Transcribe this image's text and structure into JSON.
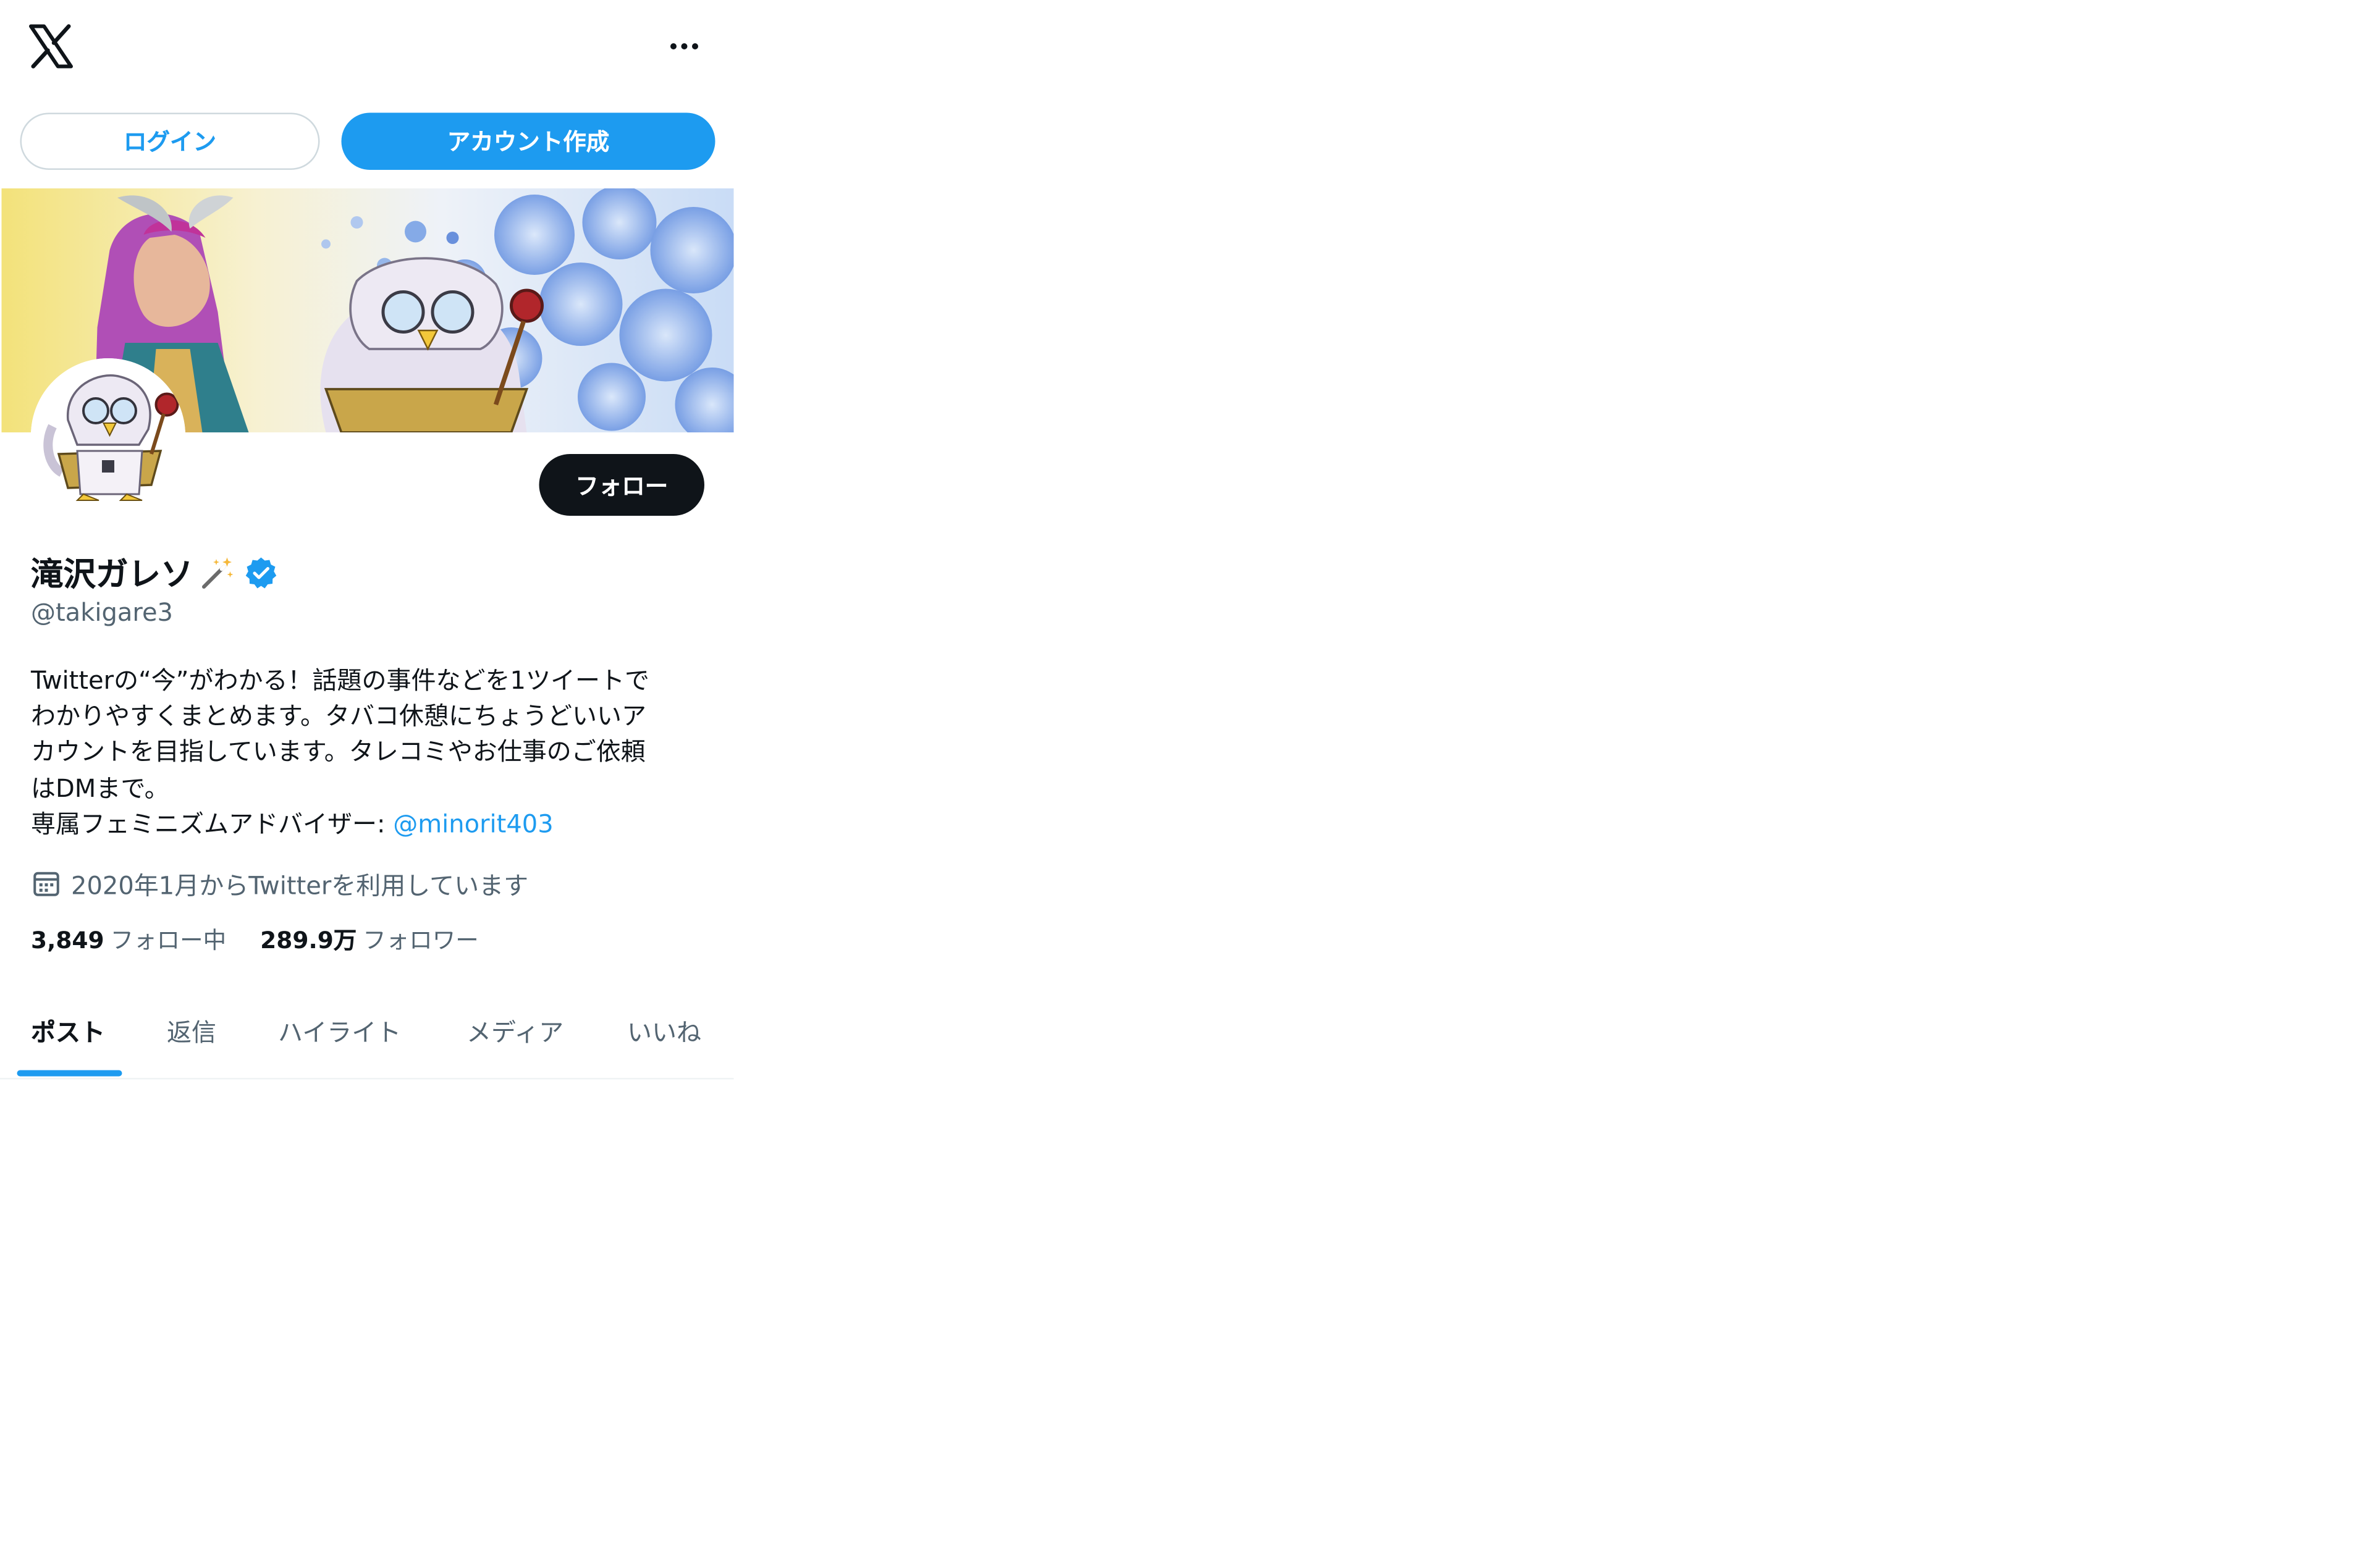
{
  "header": {
    "logo_icon": "x-logo-icon",
    "more_icon": "more-dots-icon"
  },
  "auth": {
    "login_label": "ログイン",
    "signup_label": "アカウント作成"
  },
  "profile": {
    "banner": "cover-illustration-image",
    "avatar": "penguin-mascot-avatar",
    "follow_label": "フォロー",
    "name": "滝沢ガレソ",
    "name_emoji": "magic-wand-icon",
    "verified_icon": "verified-badge-icon",
    "handle": "@takigare3",
    "bio_lines": [
      "Twitterの“今”がわかる！話題の事件などを1ツイートで",
      "わかりやすくまとめます。タバコ休憩にちょうどいいア",
      "カウントを目指しています。タレコミやお仕事のご依頼",
      "はDMまで。"
    ],
    "bio_mention_prefix": "専属フェミニズムアドバイザー: ",
    "bio_mention": "@minorit403",
    "joined": "2020年1月からTwitterを利用しています",
    "following_count": "3,849",
    "following_label": "フォロー中",
    "followers_count": "289.9万",
    "followers_label": "フォロワー"
  },
  "tabs": [
    {
      "label": "ポスト",
      "active": true
    },
    {
      "label": "返信",
      "active": false
    },
    {
      "label": "ハイライト",
      "active": false
    },
    {
      "label": "メディア",
      "active": false
    },
    {
      "label": "いいね",
      "active": false
    }
  ],
  "colors": {
    "accent": "#1d9bf0",
    "text": "#0f1419",
    "muted": "#536471",
    "border": "#cfd9de"
  }
}
